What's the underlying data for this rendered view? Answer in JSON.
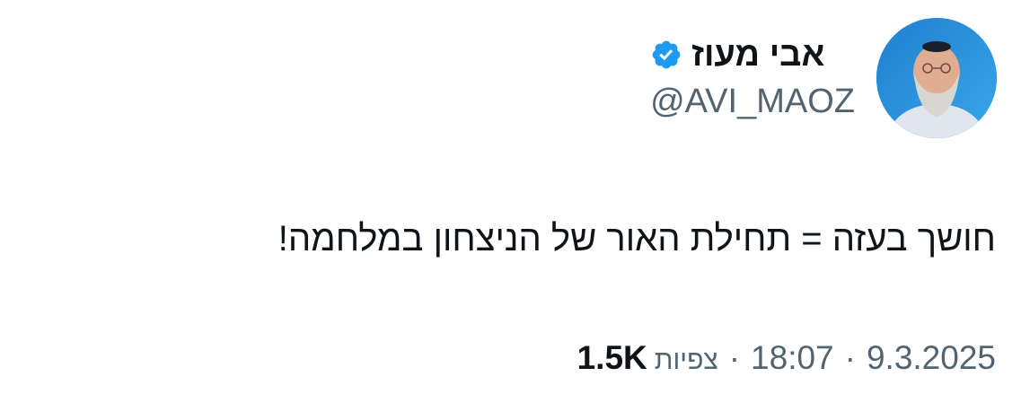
{
  "author": {
    "display_name": "אבי מעוז",
    "handle": "@AVI_MAOZ",
    "verified": true,
    "verified_color": "#1d9bf0"
  },
  "tweet": {
    "text": "חושך בעזה = תחילת האור של הניצחון במלחמה!"
  },
  "meta": {
    "date": "9.3.2025",
    "separator": "·",
    "time": "18:07",
    "views_label": "צפיות",
    "views_count": "1.5K"
  },
  "icons": {
    "avatar": "profile-photo",
    "verified": "verified-badge-icon"
  }
}
